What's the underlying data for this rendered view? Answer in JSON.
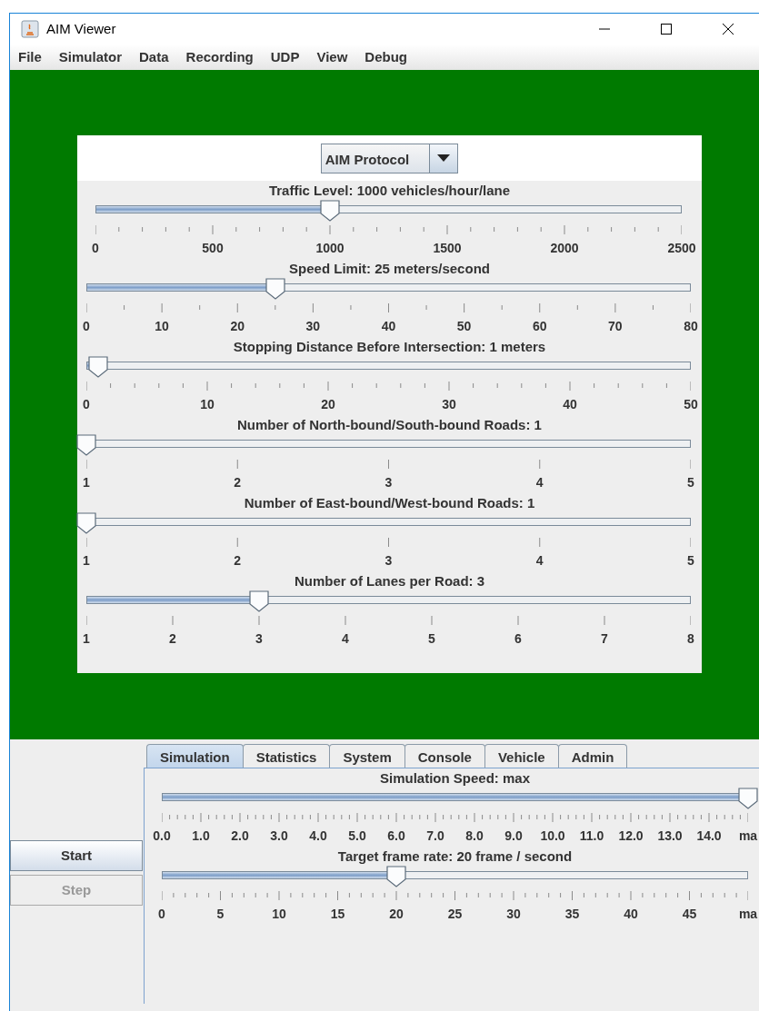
{
  "window": {
    "title": "AIM Viewer"
  },
  "menu": [
    "File",
    "Simulator",
    "Data",
    "Recording",
    "UDP",
    "View",
    "Debug"
  ],
  "protocol_dropdown": {
    "value": "AIM Protocol"
  },
  "sliders": [
    {
      "label": "Traffic Level: 1000 vehicles/hour/lane",
      "level": 0.4,
      "tick_labels": [
        "0",
        "500",
        "1000",
        "1500",
        "2000",
        "2500"
      ]
    },
    {
      "label": "Speed Limit: 25 meters/second",
      "level": 0.3125,
      "tick_labels": [
        "0",
        "10",
        "20",
        "30",
        "40",
        "50",
        "60",
        "70",
        "80"
      ]
    },
    {
      "label": "Stopping Distance Before Intersection: 1 meters",
      "level": 0.02,
      "tick_labels": [
        "0",
        "10",
        "20",
        "30",
        "40",
        "50"
      ]
    },
    {
      "label": "Number of North-bound/South-bound Roads: 1",
      "level": 0,
      "tick_labels": [
        "1",
        "2",
        "3",
        "4",
        "5"
      ]
    },
    {
      "label": "Number of East-bound/West-bound Roads: 1",
      "level": 0,
      "tick_labels": [
        "1",
        "2",
        "3",
        "4",
        "5"
      ]
    },
    {
      "label": "Number of Lanes per Road: 3",
      "level": 0.2857,
      "tick_labels": [
        "1",
        "2",
        "3",
        "4",
        "5",
        "6",
        "7",
        "8"
      ]
    }
  ],
  "buttons": [
    {
      "label": "Start",
      "disabled": false
    },
    {
      "label": "Step",
      "disabled": true
    }
  ],
  "tabs": [
    {
      "label": "Simulation",
      "selected": true
    },
    {
      "label": "Statistics",
      "selected": false
    },
    {
      "label": "System",
      "selected": false
    },
    {
      "label": "Console",
      "selected": false
    },
    {
      "label": "Vehicle",
      "selected": false
    },
    {
      "label": "Admin",
      "selected": false
    }
  ],
  "simulation_sliders": [
    {
      "label": "Simulation Speed: max",
      "level": 1,
      "tick_labels": [
        "0.0",
        "1.0",
        "2.0",
        "3.0",
        "4.0",
        "5.0",
        "6.0",
        "7.0",
        "8.0",
        "9.0",
        "10.0",
        "11.0",
        "12.0",
        "13.0",
        "14.0",
        "ma"
      ]
    },
    {
      "label": "Target frame rate: 20 frame / second",
      "level": 0.4,
      "tick_labels": [
        "0",
        "5",
        "10",
        "15",
        "20",
        "25",
        "30",
        "35",
        "40",
        "45",
        "ma"
      ]
    }
  ]
}
